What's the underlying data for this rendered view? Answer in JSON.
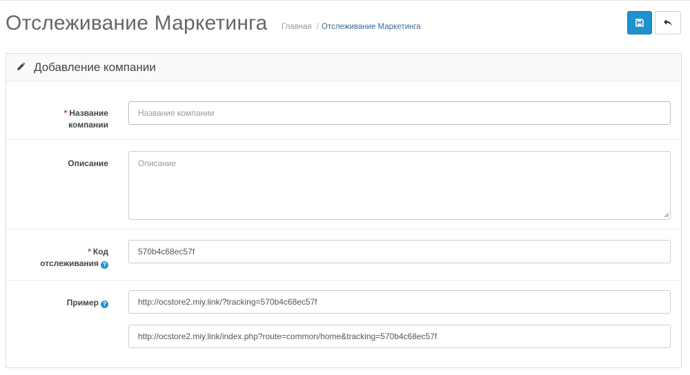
{
  "header": {
    "title": "Отслеживание Маркетинга",
    "breadcrumb": [
      {
        "label": "Главная"
      },
      {
        "label": "Отслеживание Маркетинга"
      }
    ],
    "separator": "/"
  },
  "toolbar": {
    "save_icon": "save-icon",
    "back_icon": "reply-icon",
    "save_color": "#1e91cf"
  },
  "panel": {
    "title": "Добавление компании",
    "icon": "pencil-icon"
  },
  "form": {
    "name": {
      "label_line1": "Название",
      "label_line2": "компании",
      "required": "*",
      "value": "",
      "placeholder": "Название компании"
    },
    "description": {
      "label": "Описание",
      "value": "",
      "placeholder": "Описание"
    },
    "code": {
      "label_line1": "Код",
      "label_line2": "отслеживания",
      "required": "*",
      "help": "?",
      "value": "570b4c68ec57f"
    },
    "example": {
      "label": "Пример",
      "help": "?",
      "value1": "http://ocstore2.miy.link/?tracking=570b4c68ec57f",
      "value2": "http://ocstore2.miy.link/index.php?route=common/home&tracking=570b4c68ec57f"
    }
  }
}
